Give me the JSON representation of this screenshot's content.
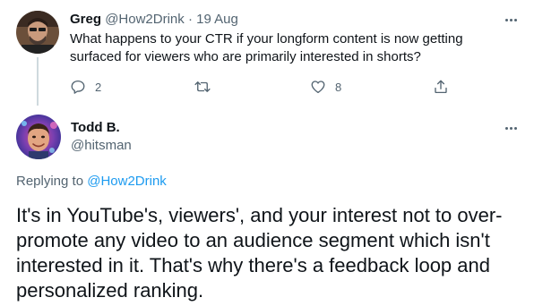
{
  "parent_tweet": {
    "author_name": "Greg",
    "author_handle": "@How2Drink",
    "separator": "·",
    "date": "19 Aug",
    "text": "What happens to your CTR if your longform content is now getting surfaced for viewers who are primarily interested in shorts?",
    "reply_count": "2",
    "like_count": "8",
    "icons": [
      "reply-icon",
      "retweet-icon",
      "like-icon",
      "share-icon",
      "more-icon"
    ]
  },
  "main_tweet": {
    "author_name": "Todd B.",
    "author_handle": "@hitsman",
    "replying_prefix": "Replying to",
    "replying_to": "@How2Drink",
    "text": "It's in YouTube's, viewers', and your interest not to over-promote any video to an audience segment which isn't interested in it. That's why there's a feedback loop and personalized ranking."
  },
  "colors": {
    "text_primary": "#0f1419",
    "text_secondary": "#536471",
    "accent": "#1d9bf0",
    "thread_line": "#cfd9de"
  }
}
